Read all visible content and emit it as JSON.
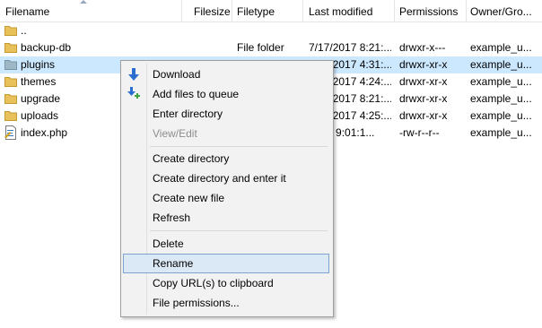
{
  "columns": {
    "filename": "Filename",
    "filesize": "Filesize",
    "filetype": "Filetype",
    "last_modified": "Last modified",
    "permissions": "Permissions",
    "owner": "Owner/Gro..."
  },
  "files": [
    {
      "name": "..",
      "size": "",
      "type": "",
      "modified": "",
      "permissions": "",
      "owner": "",
      "icon": "folder-icon"
    },
    {
      "name": "backup-db",
      "size": "",
      "type": "File folder",
      "modified": "7/17/2017 8:21:...",
      "permissions": "drwxr-x---",
      "owner": "example_u...",
      "icon": "folder-icon"
    },
    {
      "name": "plugins",
      "size": "",
      "type": "",
      "modified": "7/17/2017 4:31:...",
      "permissions": "drwxr-xr-x",
      "owner": "example_u...",
      "icon": "folder-icon",
      "selected": true
    },
    {
      "name": "themes",
      "size": "",
      "type": "",
      "modified": "7/17/2017 4:24:...",
      "permissions": "drwxr-xr-x",
      "owner": "example_u...",
      "icon": "folder-icon"
    },
    {
      "name": "upgrade",
      "size": "",
      "type": "",
      "modified": "7/17/2017 8:21:...",
      "permissions": "drwxr-xr-x",
      "owner": "example_u...",
      "icon": "folder-icon"
    },
    {
      "name": "uploads",
      "size": "",
      "type": "",
      "modified": "7/17/2017 4:25:...",
      "permissions": "drwxr-xr-x",
      "owner": "example_u...",
      "icon": "folder-icon"
    },
    {
      "name": "index.php",
      "size": "",
      "type": "",
      "modified": "2012 9:01:1...",
      "permissions": "-rw-r--r--",
      "owner": "example_u...",
      "icon": "php-file-icon"
    }
  ],
  "menu": {
    "download": "Download",
    "add_to_queue": "Add files to queue",
    "enter_directory": "Enter directory",
    "view_edit": "View/Edit",
    "create_directory": "Create directory",
    "create_directory_enter": "Create directory and enter it",
    "create_new_file": "Create new file",
    "refresh": "Refresh",
    "delete": "Delete",
    "rename": "Rename",
    "copy_url": "Copy URL(s) to clipboard",
    "file_permissions": "File permissions..."
  },
  "colors": {
    "selection": "#cce8ff",
    "menu_hover": "#dbe8f5",
    "folder": "#e8c15a"
  }
}
